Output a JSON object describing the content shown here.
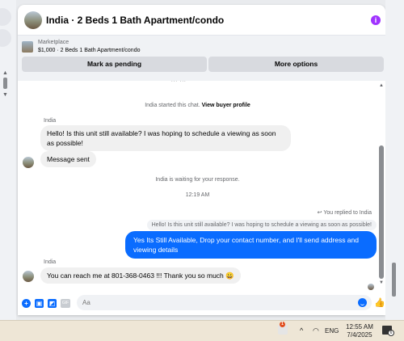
{
  "header": {
    "title": "India · 2 Beds 1 Bath Apartment/condo",
    "info_icon": "info-icon",
    "accent_color": "#a033ff"
  },
  "listing": {
    "source": "Marketplace",
    "description": "$1,000 · 2 Beds 1 Bath Apartment/condo",
    "mark_pending_label": "Mark as pending",
    "more_options_label": "More options"
  },
  "messages": {
    "cut_text": "...  ...",
    "started_prefix": "India started this chat.",
    "started_link": "View buyer profile",
    "sender_name_1": "India",
    "msg_1": "Hello! Is this unit still available? I was hoping to schedule a viewing as soon as possible!",
    "msg_2": "Message sent",
    "waiting": "India is waiting for your response.",
    "timestamp": "12:19 AM",
    "reply_note": "You replied to India",
    "quoted": "Hello! Is this unit still available? I was hoping to schedule a viewing as soon as possible!",
    "outgoing": "Yes Its Still Available, Drop your contact number, and I'll send address and viewing details",
    "sender_name_2": "India",
    "msg_3": "You can reach me at 801-368-0463 !!! Thank you so much 😀"
  },
  "composer": {
    "placeholder": "Aa",
    "icons": [
      "plus-icon",
      "image-icon",
      "sticker-icon",
      "gif-icon",
      "emoji-icon",
      "like-icon"
    ],
    "accent_color": "#0a6cff"
  },
  "taskbar": {
    "badge_count": "1",
    "language": "ENG",
    "time": "12:55 AM",
    "date": "7/4/2025",
    "notification_count": "6"
  }
}
